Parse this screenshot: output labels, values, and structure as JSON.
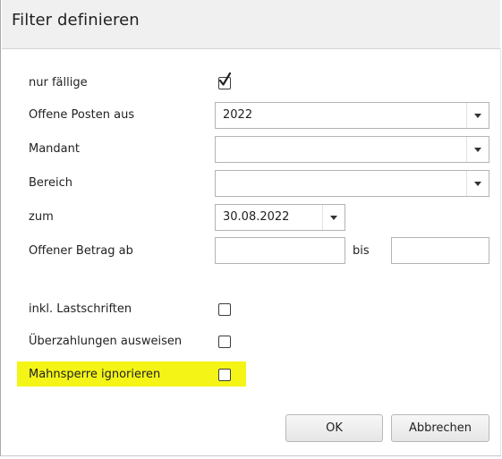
{
  "dialog": {
    "title": "Filter definieren"
  },
  "fields": {
    "nur_faellige": {
      "label": "nur fällige",
      "checked": true
    },
    "offene_posten": {
      "label": "Offene Posten aus",
      "value": "2022"
    },
    "mandant": {
      "label": "Mandant",
      "value": ""
    },
    "bereich": {
      "label": "Bereich",
      "value": ""
    },
    "zum": {
      "label": "zum",
      "value": "30.08.2022"
    },
    "offener_betrag": {
      "label": "Offener Betrag ab",
      "from": "",
      "bis_label": "bis",
      "to": ""
    },
    "lastschriften": {
      "label": "inkl. Lastschriften",
      "checked": false
    },
    "ueberzahlungen": {
      "label": "Überzahlungen ausweisen",
      "checked": false
    },
    "mahnsperre": {
      "label": "Mahnsperre ignorieren",
      "checked": false,
      "highlight_color": "#f4f516"
    }
  },
  "buttons": {
    "ok": "OK",
    "cancel": "Abbrechen"
  }
}
